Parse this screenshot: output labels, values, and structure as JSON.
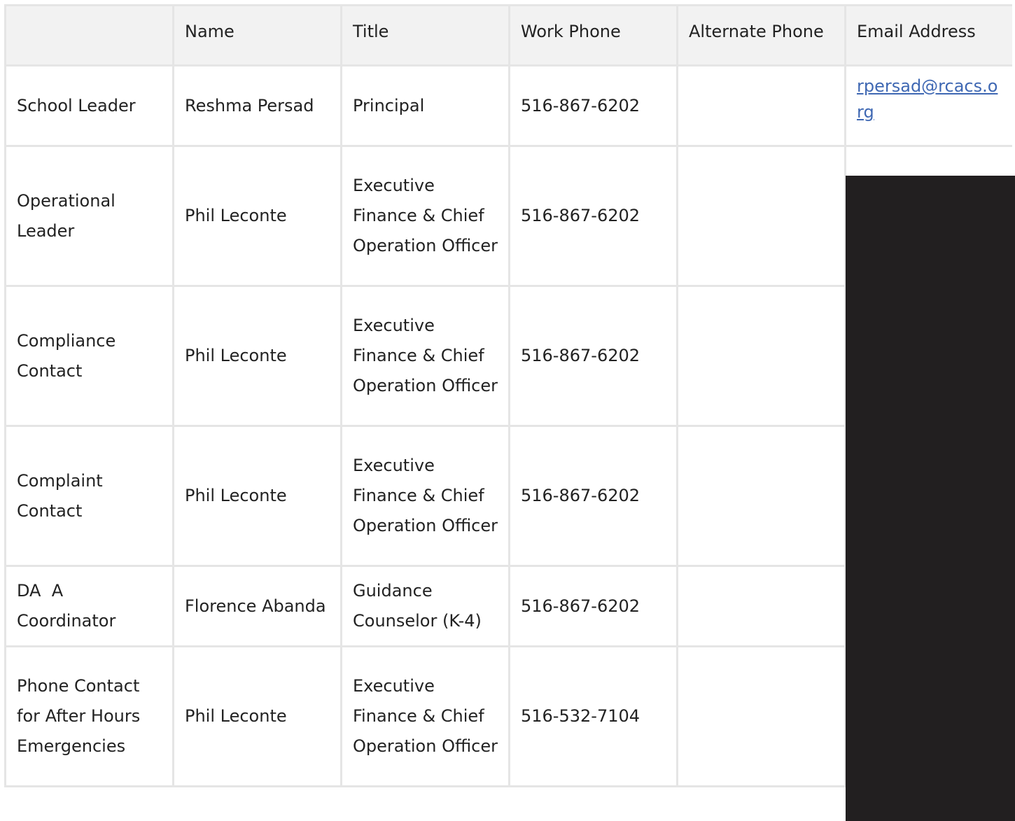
{
  "table": {
    "headers": [
      "",
      "Name",
      "Title",
      "Work Phone",
      "Alternate Phone",
      "Email Address"
    ],
    "rows": [
      {
        "role": "School Leader",
        "name": "Reshma Persad",
        "title": "Principal",
        "work_phone": "516-867-6202",
        "alternate_phone": "",
        "email": "rpersad@rcacs.org"
      },
      {
        "role": "Operational Leader",
        "name": "Phil Leconte",
        "title": "Executive Finance & Chief Operation Officer",
        "work_phone": "516-867-6202",
        "alternate_phone": "",
        "email": ""
      },
      {
        "role": "Compliance Contact",
        "name": "Phil Leconte",
        "title": "Executive Finance & Chief Operation Officer",
        "work_phone": "516-867-6202",
        "alternate_phone": "",
        "email": ""
      },
      {
        "role": "Complaint Contact",
        "name": "Phil Leconte",
        "title": "Executive Finance & Chief Operation Officer",
        "work_phone": "516-867-6202",
        "alternate_phone": "",
        "email": ""
      },
      {
        "role": "DA  A Coordinator",
        "name": "Florence Abanda",
        "title": "Guidance Counselor (K-4)",
        "work_phone": "516-867-6202",
        "alternate_phone": "",
        "email": ""
      },
      {
        "role": "Phone Contact for After Hours Emergencies",
        "name": "Phil Leconte",
        "title": "Executive Finance & Chief Operation Officer",
        "work_phone": "516-532-7104",
        "alternate_phone": "",
        "email": ""
      }
    ]
  },
  "colors": {
    "link": "#3f68b3",
    "header_bg": "#f2f2f2",
    "border": "#e5e5e5",
    "redaction": "#221f20"
  }
}
